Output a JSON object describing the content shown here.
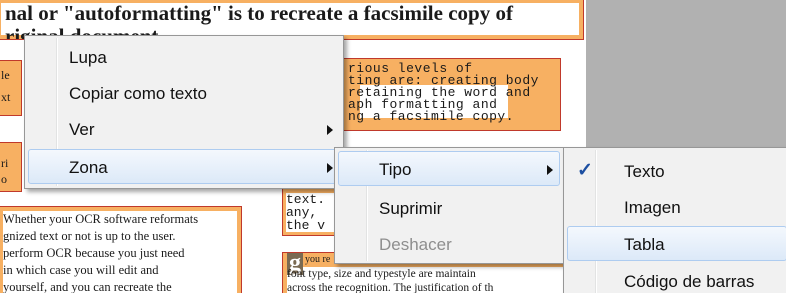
{
  "document": {
    "top_line": "nal or \"autoformatting\" is to recreate a facsimile copy of",
    "second_line": "riginal document",
    "left_fragments": [
      "le",
      "xt",
      "ri",
      "o"
    ],
    "mono_block": [
      "rious levels of",
      "ting are: creating body",
      "retaining the word and",
      "aph formatting and",
      "ng a facsimile copy."
    ],
    "lower_mono": [
      "text.",
      "any,",
      "the v"
    ],
    "serif_block": [
      "Whether your OCR software reformats",
      "gnized text or not is up to the user.",
      "perform OCR because you just need",
      "in which case you will edit and",
      "yourself, and you can recreate the"
    ],
    "right_serif": [
      "you re",
      "font type, size and typestyle are maintain",
      "across the recognition. The justification of th"
    ],
    "drop_cap": "g"
  },
  "menu_main": {
    "items": [
      {
        "label": "Lupa",
        "has_submenu": false
      },
      {
        "label": "Copiar como texto",
        "has_submenu": false
      },
      {
        "label": "Ver",
        "has_submenu": true
      },
      {
        "label": "Zona",
        "has_submenu": true
      }
    ]
  },
  "menu_zona": {
    "items": [
      {
        "label": "Tipo",
        "has_submenu": true
      },
      {
        "label": "Suprimir",
        "has_submenu": false
      },
      {
        "label": "Deshacer",
        "has_submenu": false,
        "disabled": true
      }
    ]
  },
  "menu_tipo": {
    "check_glyph": "✓",
    "items": [
      {
        "label": "Texto",
        "checked": true
      },
      {
        "label": "Imagen",
        "checked": false
      },
      {
        "label": "Tabla",
        "checked": false
      },
      {
        "label": "Código de barras",
        "checked": false
      }
    ]
  },
  "colors": {
    "zone_fill": "#f7b062",
    "zone_border": "#c0392b",
    "menu_background": "#f1f1f1",
    "highlight": "#dce9f8",
    "checkmark": "#1d4fa1"
  }
}
